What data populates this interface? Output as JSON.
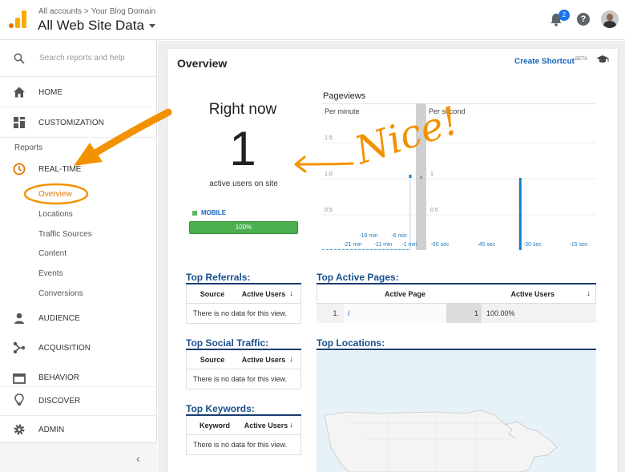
{
  "header": {
    "breadcrumb": [
      "All accounts",
      "Your Blog Domain"
    ],
    "breadcrumb_sep": ">",
    "property_title": "All Web Site Data",
    "notification_count": "2",
    "help_glyph": "?",
    "icons": [
      "analytics-logo-icon",
      "bell-icon",
      "help-icon",
      "avatar"
    ]
  },
  "sidebar": {
    "search_placeholder": "Search reports and help",
    "home": "HOME",
    "customization": "CUSTOMIZATION",
    "reports_label": "Reports",
    "realtime": "REAL-TIME",
    "realtime_items": [
      "Overview",
      "Locations",
      "Traffic Sources",
      "Content",
      "Events",
      "Conversions"
    ],
    "audience": "AUDIENCE",
    "acquisition": "ACQUISITION",
    "behavior": "BEHAVIOR",
    "discover": "DISCOVER",
    "admin": "ADMIN",
    "collapse_glyph": "‹"
  },
  "main": {
    "title": "Overview",
    "create_shortcut": "Create Shortcut",
    "beta": "BETA",
    "right_now_label": "Right now",
    "active_count": "1",
    "active_label": "active users on site",
    "device_label": "MOBILE",
    "device_percent_label": "100%",
    "device_fraction": 1.0,
    "pageviews_title": "Pageviews",
    "annotation_text": "Nice!"
  },
  "chart_data": [
    {
      "type": "bar",
      "panel": "Per minute",
      "y_ticks": [
        "1.5",
        "1.0",
        "0.5"
      ],
      "ylim": [
        0,
        1.5
      ],
      "x_ticks_lower": [
        "-21 min",
        "-11 min",
        "-1 min"
      ],
      "x_ticks_upper": [
        "-16 min",
        "-6 min"
      ],
      "values_minutes_ago": [
        {
          "x": -1,
          "y": 1
        }
      ]
    },
    {
      "type": "bar",
      "panel": "Per second",
      "y_ticks": [
        "1",
        "0.5"
      ],
      "ylim": [
        0,
        1.5
      ],
      "x_ticks": [
        "-60 sec",
        "-45 sec",
        "-30 sec",
        "-15 sec"
      ],
      "values_seconds_ago": [
        {
          "x": -30,
          "y": 1
        }
      ]
    }
  ],
  "referrals": {
    "title": "Top Referrals:",
    "col1": "Source",
    "col2": "Active Users",
    "sort_glyph": "↓",
    "empty": "There is no data for this view."
  },
  "social": {
    "title": "Top Social Traffic:",
    "col1": "Source",
    "col2": "Active Users",
    "sort_glyph": "↓",
    "empty": "There is no data for this view."
  },
  "keywords": {
    "title": "Top Keywords:",
    "col1": "Keyword",
    "col2": "Active Users",
    "sort_glyph": "↓",
    "empty": "There is no data for this view."
  },
  "active_pages": {
    "title": "Top Active Pages:",
    "col1": "Active Page",
    "col2": "Active Users",
    "sort_glyph": "↓",
    "rows": [
      {
        "rank": "1.",
        "page": "/",
        "users": "1",
        "percent": "100.00%"
      }
    ]
  },
  "locations": {
    "title": "Top Locations:"
  },
  "colors": {
    "accent_orange": "#e37400",
    "annotation_orange": "#f39200",
    "link_blue": "#1565c0",
    "bar_blue": "#1a7cc1",
    "mobile_green": "#4caf50"
  }
}
